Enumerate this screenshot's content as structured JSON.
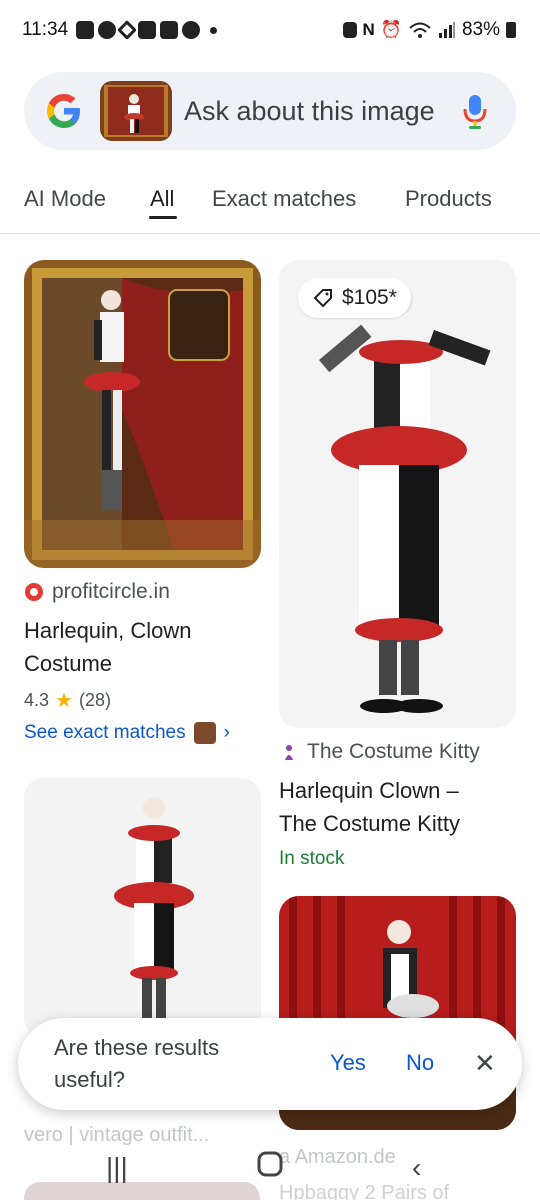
{
  "status_bar": {
    "time": "11:34",
    "battery": "83%"
  },
  "search": {
    "placeholder": "Ask about this image"
  },
  "tabs": [
    {
      "label": "AI Mode"
    },
    {
      "label": "All",
      "active": true
    },
    {
      "label": "Exact matches"
    },
    {
      "label": "Products"
    }
  ],
  "results": [
    {
      "source": "profitcircle.in",
      "title_line1": "Harlequin, Clown",
      "title_line2": "Costume",
      "rating": "4.3",
      "reviews": "(28)",
      "link": "See exact matches"
    },
    {
      "price": "$105*",
      "source": "The Costume Kitty",
      "title_line1": "Harlequin Clown –",
      "title_line2": "The Costume Kitty",
      "stock": "In stock"
    },
    {
      "source_partial": "Amazon.de",
      "title_partial": "Hpbaggy 2 Pairs of"
    },
    {
      "title_partial": "vero | vintage outfit..."
    }
  ],
  "feedback": {
    "question_line1": "Are these results",
    "question_line2": "useful?",
    "yes": "Yes",
    "no": "No"
  },
  "icons": [
    "google-logo-icon",
    "mic-icon",
    "price-tag-icon",
    "star-icon",
    "chevron-right-icon",
    "close-icon",
    "recents-icon",
    "home-icon",
    "back-icon"
  ],
  "colors": {
    "accent_blue": "#0b57d0",
    "stock_green": "#188038",
    "star": "#f4b400"
  }
}
